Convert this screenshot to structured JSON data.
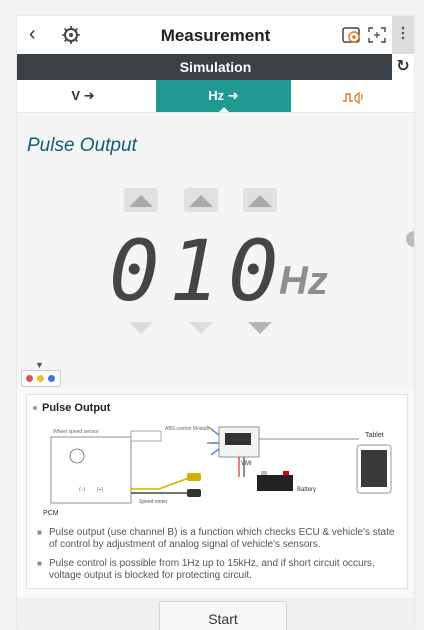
{
  "header": {
    "title": "Measurement",
    "back_icon": "chevron-left-icon"
  },
  "simulation_bar": {
    "label": "Simulation"
  },
  "tabs": [
    {
      "label": "V ➜",
      "active": false
    },
    {
      "label": "Hz ➜",
      "active": true
    },
    {
      "label": "",
      "icon": "pulse-wave-icon",
      "active": false
    }
  ],
  "panel": {
    "title": "Pulse Output",
    "digits": [
      "0",
      "1",
      "0"
    ],
    "unit": "Hz"
  },
  "channel_dots": [
    "#d9534f",
    "#e5c23a",
    "#3a7bd5"
  ],
  "description": {
    "title": "Pulse Output",
    "diagram_labels": {
      "wheel_speed_sensor": "Wheel speed sensor",
      "abs_module": "ABS control Module",
      "vmi": "VMI",
      "tablet": "Tablet",
      "battery": "Battery",
      "pcm": "PCM",
      "speed_meter": "Speed meter",
      "minus": "(−)",
      "plus": "(+)"
    },
    "bullets": [
      "Pulse output (use channel B) is a function which checks ECU & vehicle's state of control by adjustment of analog signal of vehicle's sensors.",
      "Pulse control is possible from 1Hz up to 15kHz, and if short circuit occurs, voltage output is blocked for protecting circuit."
    ]
  },
  "footer": {
    "start_label": "Start"
  },
  "colors": {
    "accent": "#1e9a93",
    "sim_bar": "#3b4045",
    "title_blue": "#0f5d7a"
  }
}
